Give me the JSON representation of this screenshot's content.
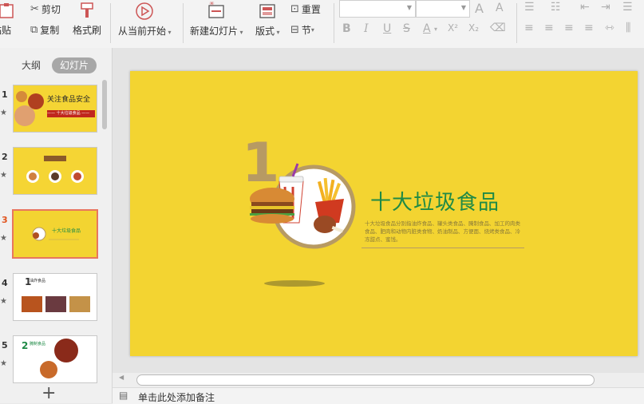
{
  "ribbon": {
    "paste_label": "粘贴",
    "cut_label": "剪切",
    "copy_label": "复制",
    "format_painter_label": "格式刷",
    "from_current_label": "从当前开始",
    "new_slide_label": "新建幻灯片",
    "layout_label": "版式",
    "reset_label": "重置",
    "section_label": "节",
    "font_size_increase": "A",
    "font_size_decrease": "A",
    "bold": "B",
    "italic": "I",
    "underline": "U",
    "strike": "S",
    "font_color": "A",
    "superscript": "X²",
    "subscript": "X₂"
  },
  "left_panel": {
    "tab_outline": "大纲",
    "tab_slides": "幻灯片",
    "slides": [
      {
        "number": "1",
        "star": "★"
      },
      {
        "number": "2",
        "star": "★"
      },
      {
        "number": "3",
        "star": "★"
      },
      {
        "number": "4",
        "star": "★"
      },
      {
        "number": "5",
        "star": "★"
      }
    ],
    "add_slide": "+"
  },
  "thumbs": {
    "s1_title": "关注食品安全",
    "s1_sub": "—— 十大垃圾食品 ——",
    "s3_title": "十大垃圾食品",
    "s4_title": "油炸食品",
    "s5_title": "腌制食品"
  },
  "slide": {
    "title": "十大垃圾食品",
    "big_number": "1",
    "body": "十大垃圾食品分别指油炸食品、罐头类食品、腌制食品、加工的肉类食品、肥肉和动物内脏类食物、奶油制品、方便面、烧烤类食品、冷冻甜点、蜜饯。",
    "colors": {
      "background": "#f3d431",
      "title": "#1f8a46",
      "number": "#b79a63"
    }
  },
  "notes": {
    "placeholder": "单击此处添加备注"
  }
}
